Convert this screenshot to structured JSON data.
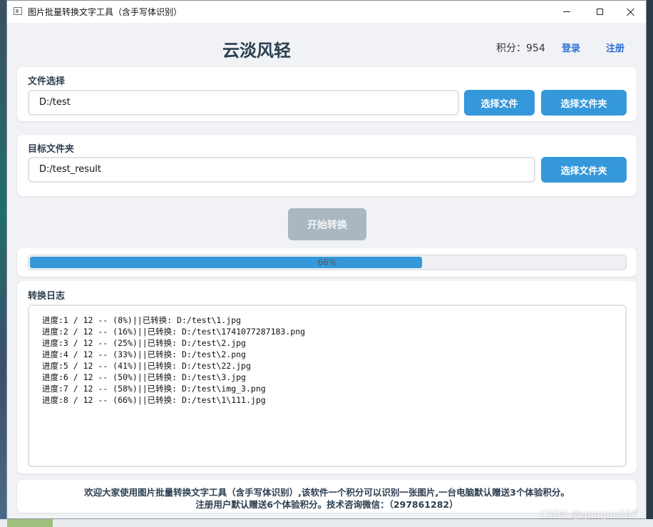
{
  "window": {
    "title": "图片批量转换文字工具（含手写体识别）"
  },
  "header": {
    "brand": "云淡风轻",
    "points": "积分：954",
    "login": "登录",
    "register": "注册"
  },
  "file_section": {
    "label": "文件选择",
    "path": "D:/test",
    "choose_file": "选择文件",
    "choose_folder": "选择文件夹"
  },
  "target_section": {
    "label": "目标文件夹",
    "path": "D:/test_result",
    "choose_folder": "选择文件夹"
  },
  "start_button": "开始转换",
  "progress": {
    "value": 66,
    "text": "66%"
  },
  "log": {
    "label": "转换日志",
    "lines": [
      "进度:1 / 12 -- (8%)||已转换: D:/test\\1.jpg",
      "进度:2 / 12 -- (16%)||已转换: D:/test\\1741077287183.png",
      "进度:3 / 12 -- (25%)||已转换: D:/test\\2.jpg",
      "进度:4 / 12 -- (33%)||已转换: D:/test\\2.png",
      "进度:5 / 12 -- (41%)||已转换: D:/test\\22.jpg",
      "进度:6 / 12 -- (50%)||已转换: D:/test\\3.jpg",
      "进度:7 / 12 -- (58%)||已转换: D:/test\\img_3.png",
      "进度:8 / 12 -- (66%)||已转换: D:/test\\1\\111.jpg"
    ]
  },
  "footer": {
    "line1": "欢迎大家使用图片批量转换文字工具（含手写体识别）,该软件一个积分可以识别一张图片,一台电脑默认赠送3个体验积分。",
    "line2": "注册用户默认赠送6个体验积分。技术咨询微信：（297861282）"
  },
  "watermark": "CSDN @guoguo507",
  "colors": {
    "accent": "#3498db",
    "disabled": "#aab7c0",
    "heading": "#2c3e50",
    "link": "#2f6fd6"
  }
}
